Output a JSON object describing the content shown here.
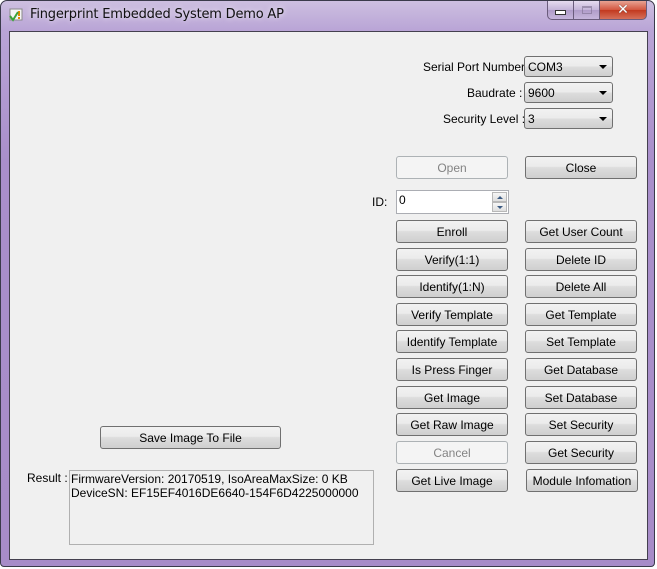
{
  "window": {
    "title": "Fingerprint Embedded System Demo AP",
    "app_icon": "app-check-icon",
    "caption_buttons": [
      "minimize",
      "maximize",
      "close"
    ]
  },
  "settings": {
    "serial_port": {
      "label": "Serial Port Number :",
      "value": "COM3"
    },
    "baudrate": {
      "label": "Baudrate :",
      "value": "9600"
    },
    "security_level": {
      "label": "Security Level :",
      "value": "3"
    }
  },
  "connection": {
    "open_label": "Open",
    "open_enabled": false,
    "close_label": "Close"
  },
  "id_field": {
    "label": "ID:",
    "value": "0"
  },
  "buttons_left": [
    {
      "label": "Enroll",
      "enabled": true
    },
    {
      "label": "Verify(1:1)",
      "enabled": true
    },
    {
      "label": "Identify(1:N)",
      "enabled": true
    },
    {
      "label": "Verify Template",
      "enabled": true
    },
    {
      "label": "Identify Template",
      "enabled": true
    },
    {
      "label": "Is Press Finger",
      "enabled": true
    },
    {
      "label": "Get Image",
      "enabled": true
    },
    {
      "label": "Get Raw Image",
      "enabled": true
    },
    {
      "label": "Cancel",
      "enabled": false
    },
    {
      "label": "Get Live Image",
      "enabled": true
    }
  ],
  "buttons_right": [
    {
      "label": "Get User Count"
    },
    {
      "label": "Delete ID"
    },
    {
      "label": "Delete All"
    },
    {
      "label": "Get Template"
    },
    {
      "label": "Set Template"
    },
    {
      "label": "Get Database"
    },
    {
      "label": "Set Database"
    },
    {
      "label": "Set Security"
    },
    {
      "label": "Get Security"
    },
    {
      "label": "Module Infomation"
    }
  ],
  "save_image_label": "Save Image To File",
  "result": {
    "label": "Result :",
    "lines": [
      "FirmwareVersion: 20170519, IsoAreaMaxSize: 0 KB",
      "DeviceSN: EF15EF4016DE6640-154F6D4225000000"
    ]
  }
}
